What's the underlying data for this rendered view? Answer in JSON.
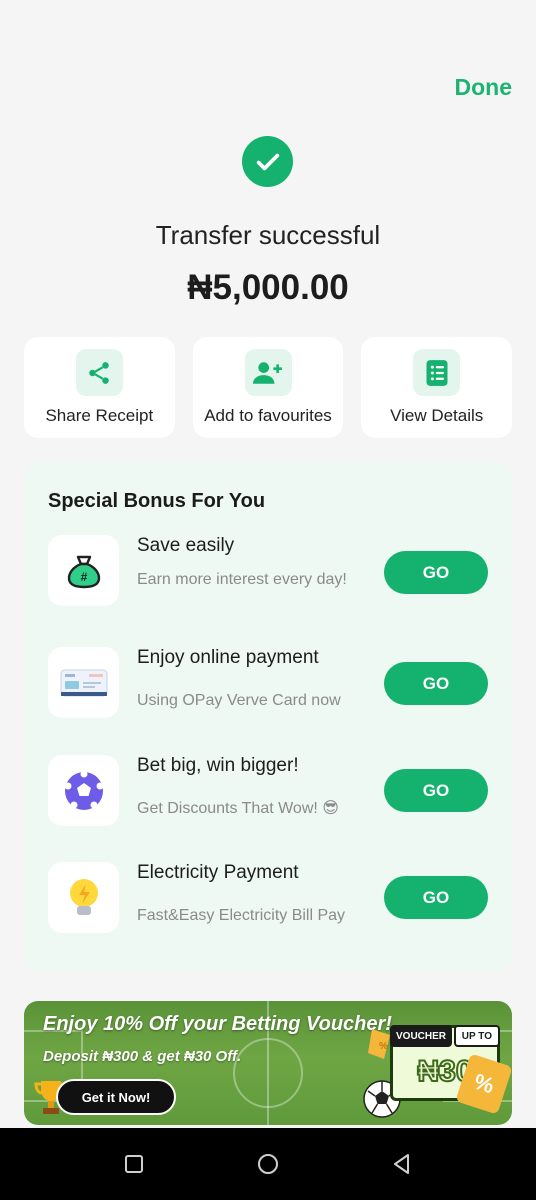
{
  "header": {
    "done_label": "Done"
  },
  "status": {
    "title": "Transfer successful",
    "amount": "₦5,000.00"
  },
  "actions": [
    {
      "label": "Share Receipt",
      "icon": "share-icon"
    },
    {
      "label": "Add to favourites",
      "icon": "add-user-icon"
    },
    {
      "label": "View Details",
      "icon": "list-details-icon"
    }
  ],
  "bonus": {
    "title": "Special Bonus For You",
    "items": [
      {
        "title": "Save easily",
        "subtitle": "Earn more interest every day!",
        "cta": "GO",
        "icon": "money-bag-icon"
      },
      {
        "title": "Enjoy online payment",
        "subtitle": "Using OPay Verve Card now",
        "cta": "GO",
        "icon": "verve-card-icon"
      },
      {
        "title": "Bet big, win bigger!",
        "subtitle": "Get Discounts That Wow! 😎",
        "cta": "GO",
        "icon": "football-icon"
      },
      {
        "title": "Electricity Payment",
        "subtitle": "Fast&Easy Electricity Bill Pay",
        "cta": "GO",
        "icon": "light-bulb-icon"
      }
    ]
  },
  "promo": {
    "headline": "Enjoy 10% Off your Betting Voucher!",
    "sub": "Deposit ₦300 & get ₦30 Off.",
    "cta": "Get it Now!",
    "voucher_tag": "VOUCHER",
    "voucher_upto": "UP TO",
    "voucher_amount": "₦30",
    "percent_tag": "%"
  },
  "colors": {
    "accent": "#14b26e",
    "done": "#1db371",
    "bonus_bg": "#eef9f3"
  }
}
